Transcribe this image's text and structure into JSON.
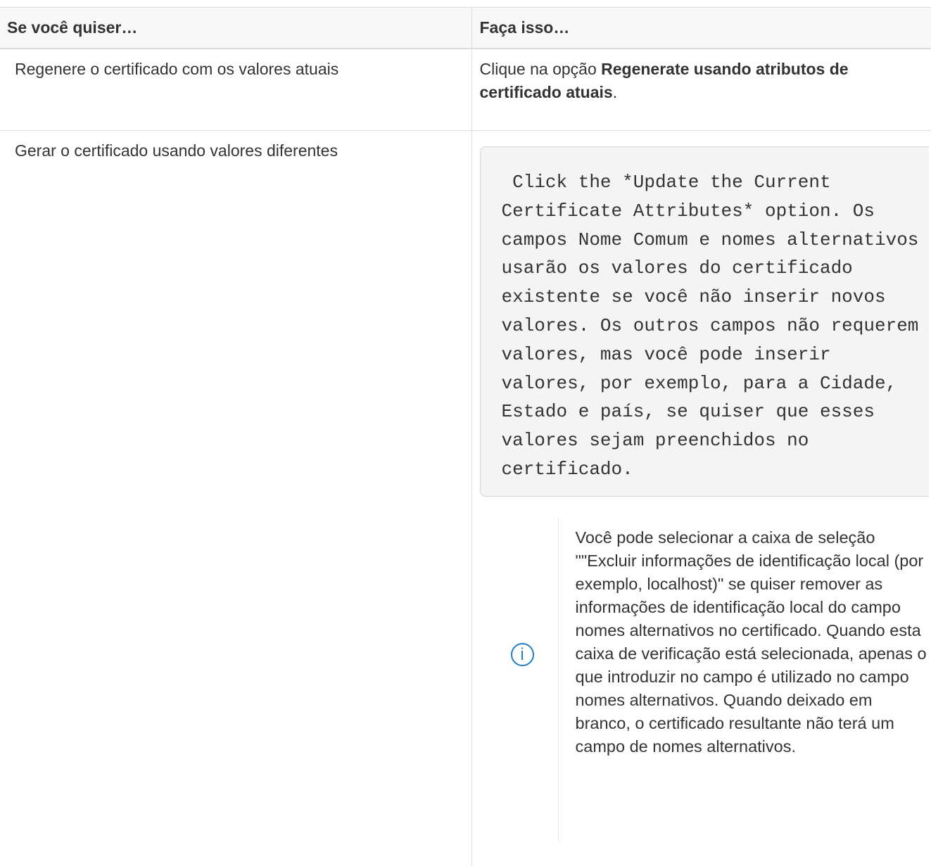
{
  "table": {
    "header": {
      "col1": "Se você quiser…",
      "col2": "Faça isso…"
    },
    "rows": [
      {
        "when": "Regenere o certificado com os valores atuais",
        "action_prefix": "Clique na opção ",
        "action_bold": "Regenerate usando atributos de certificado atuais",
        "action_suffix": "."
      },
      {
        "when": "Gerar o certificado usando valores diferentes",
        "code_block": " Click the *Update the Current Certificate Attributes* option. Os campos Nome Comum e nomes alternativos usarão os valores do certificado existente se você não inserir novos valores. Os outros campos não requerem valores, mas você pode inserir valores, por exemplo, para a Cidade, Estado e país, se quiser que esses valores sejam preenchidos no certificado.",
        "note_icon": "info-icon",
        "note_text": "Você pode selecionar a caixa de seleção \"\"Excluir informações de identificação local (por exemplo, localhost)\" se quiser remover as informações de identificação local do campo nomes alternativos no certificado. Quando esta caixa de verificação está selecionada, apenas o que introduzir no campo é utilizado no campo nomes alternativos. Quando deixado em branco, o certificado resultante não terá um campo de nomes alternativos."
      }
    ]
  },
  "colors": {
    "text": "#333333",
    "header_bg": "#f7f8f7",
    "code_bg": "#f4f4f4",
    "info_icon": "#1f7fc9"
  }
}
